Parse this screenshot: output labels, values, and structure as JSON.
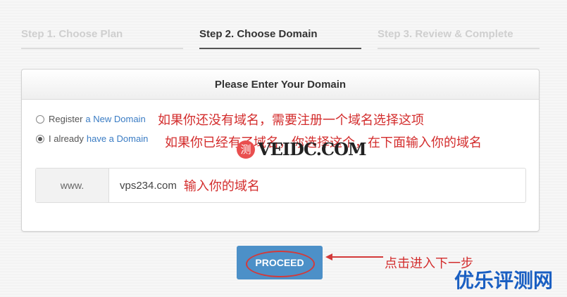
{
  "steps": [
    {
      "label": "Step 1. Choose Plan",
      "active": false
    },
    {
      "label": "Step 2. Choose Domain",
      "active": true
    },
    {
      "label": "Step 3. Review & Complete",
      "active": false
    }
  ],
  "panel": {
    "title": "Please Enter Your Domain",
    "options": [
      {
        "prefix": "Register",
        "link": "a New Domain",
        "checked": false,
        "annotation": "如果你还没有域名，需要注册一个域名选择这项"
      },
      {
        "prefix": "I already",
        "link": "have a Domain",
        "checked": true,
        "annotation": "如果你已经有了域名，你选择这个，在下面输入你的域名"
      }
    ],
    "domain": {
      "prefix": "www.",
      "value": "vps234.com",
      "annotation": "输入你的域名"
    }
  },
  "watermark": {
    "badge": "测",
    "text": "VEIDC.COM"
  },
  "proceed": {
    "label": "PROCEED",
    "annotation": "点击进入下一步"
  },
  "corner_brand": "优乐评测网",
  "colors": {
    "accent": "#4c90c8",
    "annotation": "#d32d2d",
    "link": "#3a7cc4",
    "brand": "#1a5fc2"
  }
}
